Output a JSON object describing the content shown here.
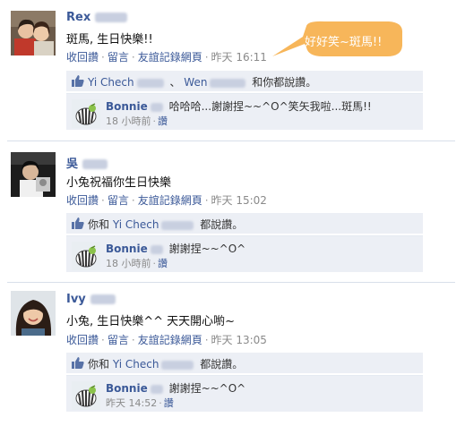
{
  "posts": [
    {
      "name": "Rex",
      "message": "斑馬, 生日快樂!!",
      "actions": [
        "收回讚",
        "留言",
        "友誼記錄網頁"
      ],
      "time": "昨天 16:11",
      "likes": {
        "person1": "Yi Chech",
        "joiner": "、",
        "person2": "Wen",
        "suffix": "和你都說讚。"
      },
      "reply": {
        "name": "Bonnie",
        "text": "哈哈哈...謝謝捏~~^O^笑矢我啦...斑馬!!",
        "time": "18 小時前",
        "action": "讚"
      }
    },
    {
      "name": "吳",
      "message": "小兔祝福你生日快樂",
      "actions": [
        "收回讚",
        "留言",
        "友誼記錄網頁"
      ],
      "time": "昨天 15:02",
      "likes": {
        "prefix": "你和",
        "person1": "Yi Chech",
        "suffix": "都說讚。"
      },
      "reply": {
        "name": "Bonnie",
        "text": "謝謝捏~~^O^",
        "time": "18 小時前",
        "action": "讚"
      }
    },
    {
      "name": "Ivy",
      "message": "小兔, 生日快樂^^ 天天開心喲~",
      "actions": [
        "收回讚",
        "留言",
        "友誼記錄網頁"
      ],
      "time": "昨天 13:05",
      "likes": {
        "prefix": "你和",
        "person1": "Yi Chech",
        "suffix": "都說讚。"
      },
      "reply": {
        "name": "Bonnie",
        "text": "謝謝捏~~^O^",
        "time": "昨天 14:52",
        "action": "讚"
      }
    }
  ],
  "annotation": {
    "text": "好好笑~斑馬!!",
    "color": "#f7b65a"
  },
  "separator": "·",
  "colors": {
    "link": "#3b5998",
    "like_bg": "#eceff5",
    "divider": "#d8dfea"
  }
}
